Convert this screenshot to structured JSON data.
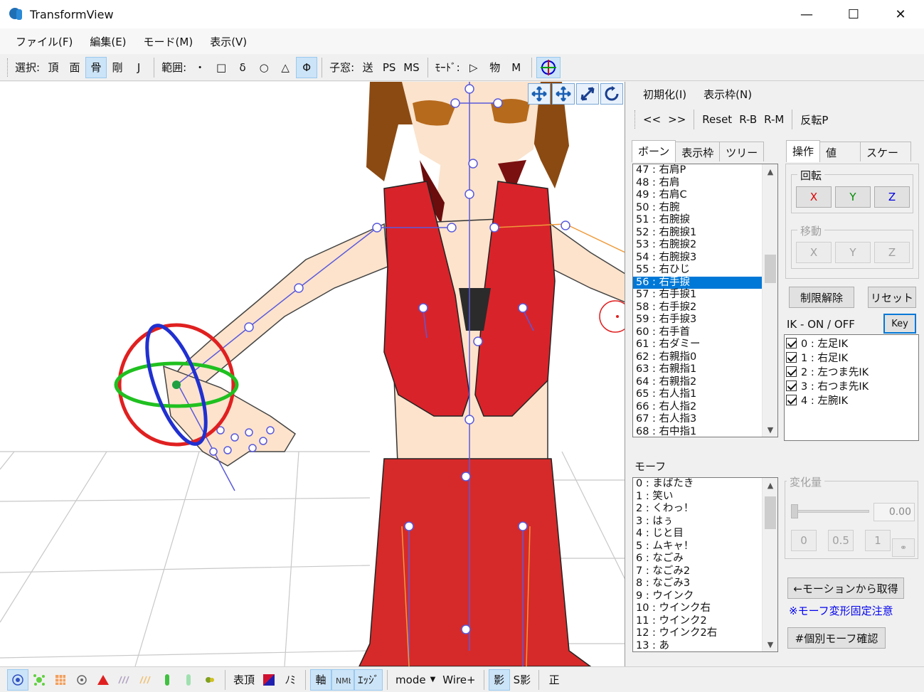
{
  "window": {
    "title": "TransformView"
  },
  "menubar": {
    "items": [
      "ファイル(F)",
      "編集(E)",
      "モード(M)",
      "表示(V)"
    ]
  },
  "toolbar": {
    "select_label": "選択:",
    "select_items": [
      "頂",
      "面",
      "骨",
      "剛",
      "J"
    ],
    "select_pressed": "骨",
    "range_label": "範囲:",
    "range_items": [
      "・",
      "□",
      "δ",
      "○",
      "△",
      "Φ"
    ],
    "range_pressed": "Φ",
    "child_label": "子窓:",
    "child_items": [
      "送",
      "PS",
      "MS"
    ],
    "mode_label": "ﾓｰﾄﾞ:",
    "mode_items": [
      "▷",
      "物",
      "M"
    ]
  },
  "right_panel": {
    "menu": [
      "初期化(I)",
      "表示枠(N)"
    ],
    "toolbar": [
      "<<",
      ">>",
      "Reset",
      "R-B",
      "R-M",
      "反転P"
    ],
    "bone_tabs": [
      "ボーン",
      "表示枠",
      "ツリー"
    ],
    "bone_tab_active": 0,
    "bones": [
      "47 : 右肩P",
      "48 : 右肩",
      "49 : 右肩C",
      "50 : 右腕",
      "51 : 右腕捩",
      "52 : 右腕捩1",
      "53 : 右腕捩2",
      "54 : 右腕捩3",
      "55 : 右ひじ",
      "56 : 右手捩",
      "57 : 右手捩1",
      "58 : 右手捩2",
      "59 : 右手捩3",
      "60 : 右手首",
      "61 : 右ダミー",
      "62 : 右親指0",
      "63 : 右親指1",
      "64 : 右親指2",
      "65 : 右人指1",
      "66 : 右人指2",
      "67 : 右人指3",
      "68 : 右中指1"
    ],
    "bone_selected": "56 : 右手捩",
    "op_tabs": [
      "操作",
      "値",
      "スケール"
    ],
    "op_tab_active": 0,
    "rotation": {
      "label": "回転",
      "buttons": [
        "X",
        "Y",
        "Z"
      ],
      "colors": [
        "#e00000",
        "#008a00",
        "#0000e0"
      ]
    },
    "move": {
      "label": "移動",
      "buttons": [
        "X",
        "Y",
        "Z"
      ]
    },
    "unlock_button": "制限解除",
    "reset_button": "リセット",
    "ik_label": "IK -  ON  /  OFF",
    "key_button": "Key",
    "ik_items": [
      "0 : 左足IK",
      "1 : 右足IK",
      "2 : 左つま先IK",
      "3 : 右つま先IK",
      "4 : 左腕IK"
    ],
    "morph_label": "モーフ",
    "morphs": [
      "0 : まばたき",
      "1 : 笑い",
      "2 : くわっ！",
      "3 : はぅ",
      "4 : じと目",
      "5 : ムキャ！",
      "6 : なごみ",
      "7 : なごみ2",
      "8 : なごみ3",
      "9 : ウインク",
      "10 : ウインク右",
      "11 : ウインク2",
      "12 : ウインク2右",
      "13 : あ"
    ],
    "change_amount": {
      "label": "変化量",
      "value": "0.00",
      "slider": 0.0,
      "presets": [
        "0",
        "0.5",
        "1"
      ]
    },
    "motion_get_button": "←モーションから取得",
    "morph_note": "※モーフ変形固定注意",
    "morph_check_button": "#個別モーフ確認"
  },
  "bottombar": {
    "text_items": [
      "表頂",
      "ﾉﾐ",
      "軸",
      "ｴｯｼﾞ",
      "mode",
      "Wire+",
      "影",
      "S影",
      "正"
    ]
  }
}
